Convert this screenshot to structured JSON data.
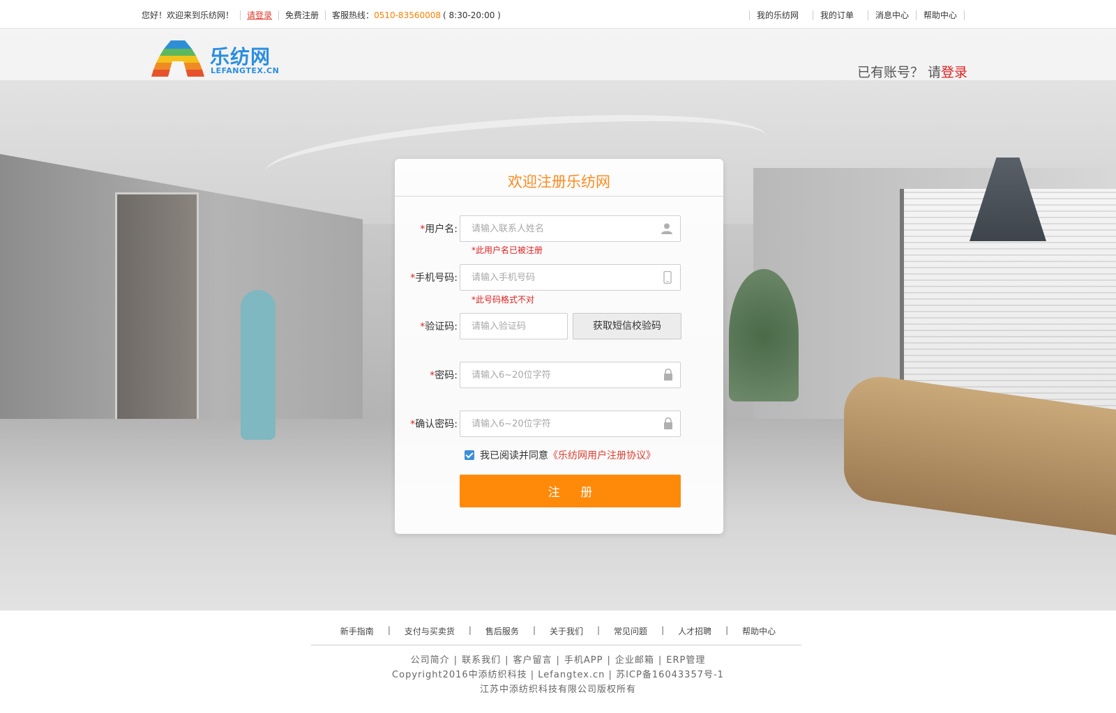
{
  "topbar": {
    "greeting": "您好！欢迎来到乐纺网！",
    "login": "请登录",
    "register": "免费注册",
    "hotline_label": "客服热线：",
    "hotline_number": "0510-83560008",
    "hotline_hours": "( 8:30-20:00 )",
    "right_links": [
      "我的乐纺网",
      "我的订单",
      "消息中心",
      "帮助中心"
    ]
  },
  "header": {
    "logo_cn": "乐纺网",
    "logo_en": "LEFANGTEX.CN",
    "has_account": "已有账号？ 请",
    "login": "登录"
  },
  "form": {
    "title": "欢迎注册乐纺网",
    "username": {
      "label": "用户名:",
      "placeholder": "请输入联系人姓名",
      "error": "*此用户名已被注册",
      "icon": "user-icon"
    },
    "phone": {
      "label": "手机号码:",
      "placeholder": "请输入手机号码",
      "error": "*此号码格式不对",
      "icon": "mobile-phone-icon"
    },
    "code": {
      "label": "验证码:",
      "placeholder": "请输入验证码",
      "button": "获取短信校验码"
    },
    "password": {
      "label": "密码:",
      "placeholder": "请输入6~20位字符",
      "icon": "lock-icon"
    },
    "confirm": {
      "label": "确认密码:",
      "placeholder": "请输入6~20位字符",
      "icon": "lock-icon"
    },
    "agree_text": "我已阅读并同意",
    "agree_link": "《乐纺网用户注册协议》",
    "agreed": true,
    "submit": "注 册"
  },
  "footer": {
    "nav": [
      "新手指南",
      "支付与买卖货",
      "售后服务",
      "关于我们",
      "常见问题",
      "人才招聘",
      "帮助中心"
    ],
    "links": [
      "公司简介",
      "联系我们",
      "客户留言",
      "手机APP",
      "企业邮箱",
      "ERP管理"
    ],
    "copyright": "Copyright2016中添纺织科技 | Lefangtex.cn | 苏ICP备16043357号-1",
    "company": "江苏中添纺织科技有限公司版权所有"
  },
  "colors": {
    "accent": "#ff8a0a",
    "title": "#ff8a1f",
    "error": "#e02020",
    "link_red": "#e03c2e",
    "logo_blue": "#2a8ee0"
  }
}
